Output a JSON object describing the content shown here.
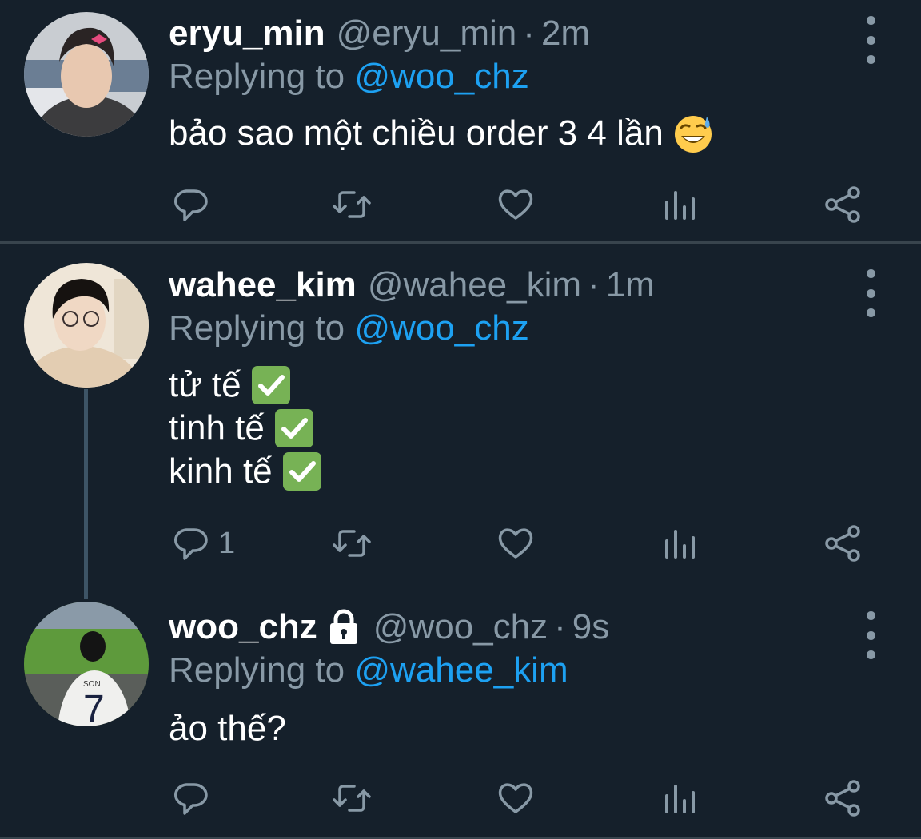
{
  "tweets": [
    {
      "name": "eryu_min",
      "handle": "@eryu_min",
      "separator": "·",
      "time": "2m",
      "replying_prefix": "Replying to",
      "replying_to": "@woo_chz",
      "lines": [
        "bảo sao một chiều order 3 4 lần"
      ],
      "emoji": [
        "sweat-smile-emoji"
      ],
      "reply_count": ""
    },
    {
      "name": "wahee_kim",
      "handle": "@wahee_kim",
      "separator": "·",
      "time": "1m",
      "replying_prefix": "Replying to",
      "replying_to": "@woo_chz",
      "lines": [
        "tử tế",
        "tinh tế",
        "kinh tế"
      ],
      "emoji": [
        "check-mark-emoji",
        "check-mark-emoji",
        "check-mark-emoji"
      ],
      "reply_count": "1"
    },
    {
      "name": "woo_chz",
      "handle": "@woo_chz",
      "separator": "·",
      "time": "9s",
      "replying_prefix": "Replying to",
      "replying_to": "@wahee_kim",
      "lines": [
        "ảo thế?"
      ],
      "emoji": [],
      "reply_count": "",
      "protected_icon": "lock-icon"
    }
  ],
  "colors": {
    "background": "#15202b",
    "secondary_text": "#8899a6",
    "link": "#1da1f2",
    "divider": "#38444d",
    "thread_line": "#3d5466"
  },
  "icons": [
    "reply-icon",
    "retweet-icon",
    "like-icon",
    "analytics-icon",
    "share-icon",
    "more-icon"
  ]
}
